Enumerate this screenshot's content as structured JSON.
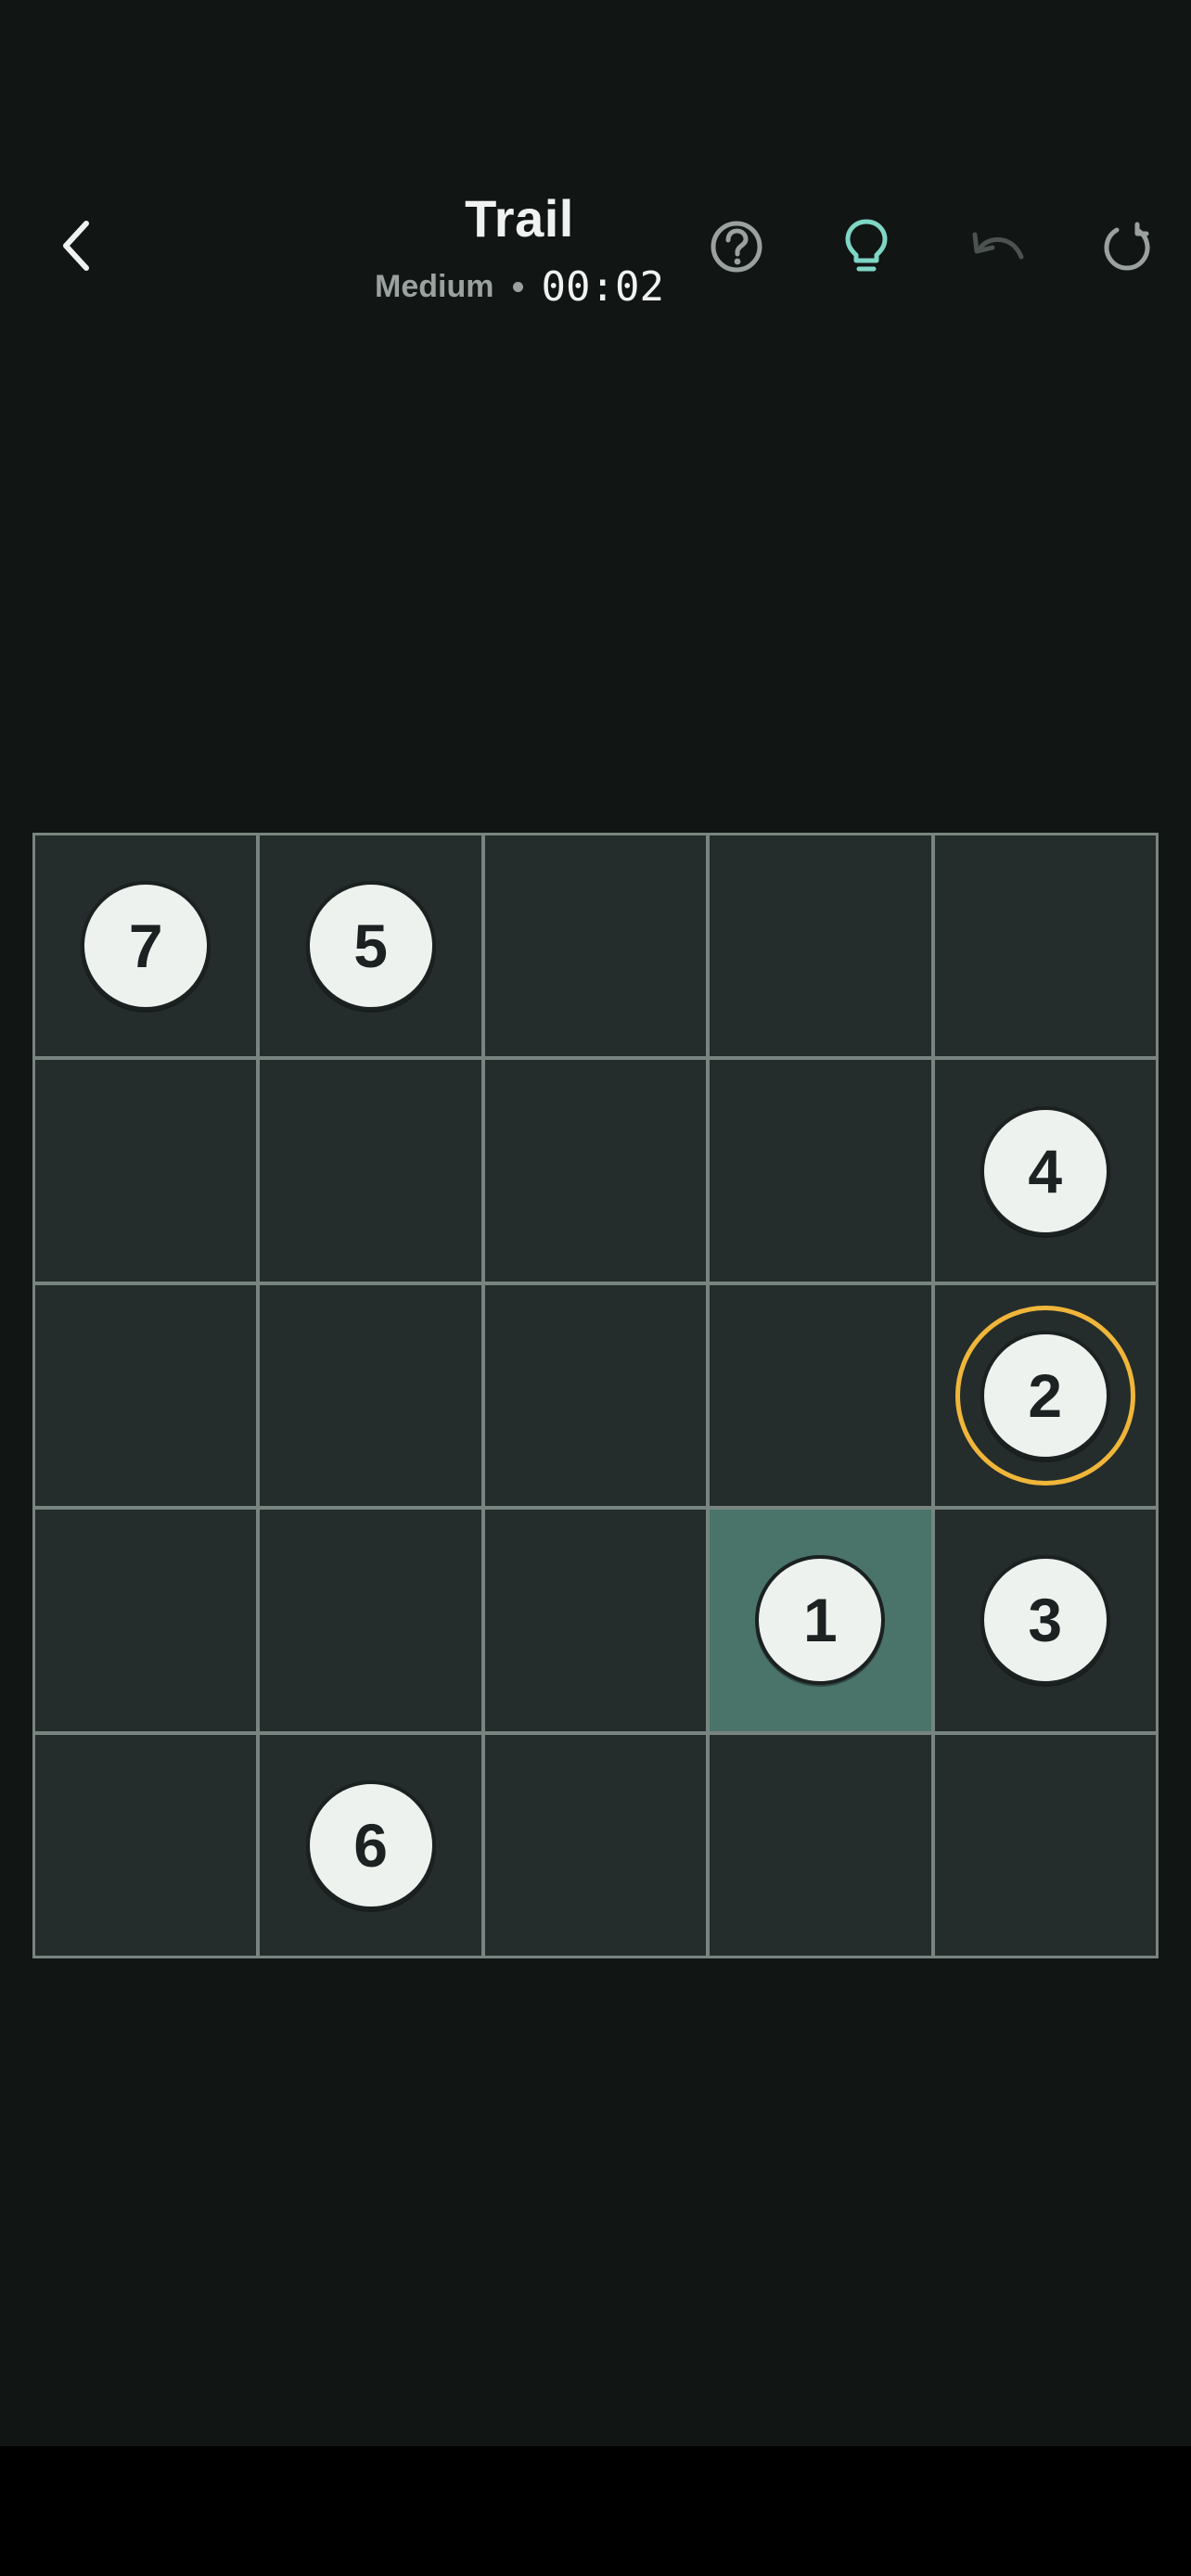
{
  "header": {
    "title": "Trail",
    "difficulty": "Medium",
    "timer": "00:02"
  },
  "icons": {
    "back": "chevron-left-icon",
    "help": "help-circle-icon",
    "hint": "lightbulb-icon",
    "undo": "undo-icon",
    "restart": "restart-icon"
  },
  "colors": {
    "background": "#111514",
    "cell": "#242d2b",
    "grid_line": "#78847f",
    "visited_cell": "#4a736a",
    "node_fill": "#eef2ef",
    "current_ring": "#f0b63a",
    "hint_icon": "#7fd6c4",
    "icon_default": "#9aa19e",
    "icon_disabled": "#4b5250"
  },
  "board": {
    "rows": 5,
    "cols": 5,
    "cells": [
      {
        "row": 0,
        "col": 0,
        "number": "7"
      },
      {
        "row": 0,
        "col": 1,
        "number": "5"
      },
      {
        "row": 0,
        "col": 2,
        "number": ""
      },
      {
        "row": 0,
        "col": 3,
        "number": ""
      },
      {
        "row": 0,
        "col": 4,
        "number": ""
      },
      {
        "row": 1,
        "col": 0,
        "number": ""
      },
      {
        "row": 1,
        "col": 1,
        "number": ""
      },
      {
        "row": 1,
        "col": 2,
        "number": ""
      },
      {
        "row": 1,
        "col": 3,
        "number": ""
      },
      {
        "row": 1,
        "col": 4,
        "number": "4"
      },
      {
        "row": 2,
        "col": 0,
        "number": ""
      },
      {
        "row": 2,
        "col": 1,
        "number": ""
      },
      {
        "row": 2,
        "col": 2,
        "number": ""
      },
      {
        "row": 2,
        "col": 3,
        "number": ""
      },
      {
        "row": 2,
        "col": 4,
        "number": "2",
        "current": true
      },
      {
        "row": 3,
        "col": 0,
        "number": ""
      },
      {
        "row": 3,
        "col": 1,
        "number": ""
      },
      {
        "row": 3,
        "col": 2,
        "number": ""
      },
      {
        "row": 3,
        "col": 3,
        "number": "1",
        "visited": true
      },
      {
        "row": 3,
        "col": 4,
        "number": "3"
      },
      {
        "row": 4,
        "col": 0,
        "number": ""
      },
      {
        "row": 4,
        "col": 1,
        "number": "6"
      },
      {
        "row": 4,
        "col": 2,
        "number": ""
      },
      {
        "row": 4,
        "col": 3,
        "number": ""
      },
      {
        "row": 4,
        "col": 4,
        "number": ""
      }
    ]
  }
}
